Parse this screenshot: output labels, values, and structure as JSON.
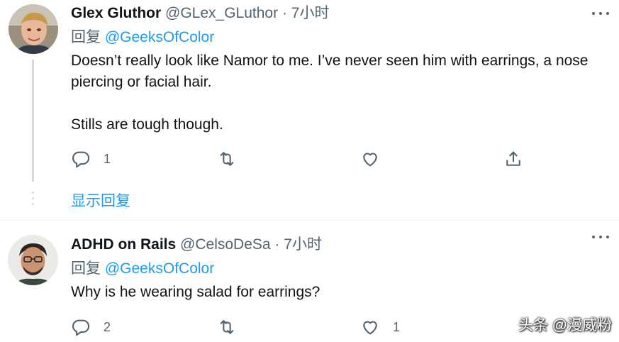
{
  "tweets": [
    {
      "author_name": "Glex Gluthor",
      "handle": "@GLex_GLuthor",
      "separator": "·",
      "time": "7小时",
      "reply_prefix": "回复",
      "reply_mention": "@GeeksOfColor",
      "paragraphs": [
        "Doesn’t really look like Namor to me. I’ve never seen him with earrings, a nose piercing or facial hair.",
        "Stills are tough though."
      ],
      "actions": {
        "reply_count": "1",
        "retweet_count": "",
        "like_count": ""
      },
      "show_replies": "显示回复"
    },
    {
      "author_name": "ADHD on Rails",
      "handle": "@CelsoDeSa",
      "separator": "·",
      "time": "7小时",
      "reply_prefix": "回复",
      "reply_mention": "@GeeksOfColor",
      "paragraphs": [
        "Why is he wearing salad for earrings?"
      ],
      "actions": {
        "reply_count": "2",
        "retweet_count": "",
        "like_count": "1"
      }
    }
  ],
  "watermark": "头条 @漫威粉",
  "colors": {
    "link": "#1d9bf0",
    "secondary_text": "#536471",
    "primary_text": "#0f1419",
    "thread_line": "#cfd9de",
    "divider": "#eff3f4"
  },
  "icons": [
    "reply-icon",
    "retweet-icon",
    "like-icon",
    "share-icon",
    "more-icon"
  ]
}
